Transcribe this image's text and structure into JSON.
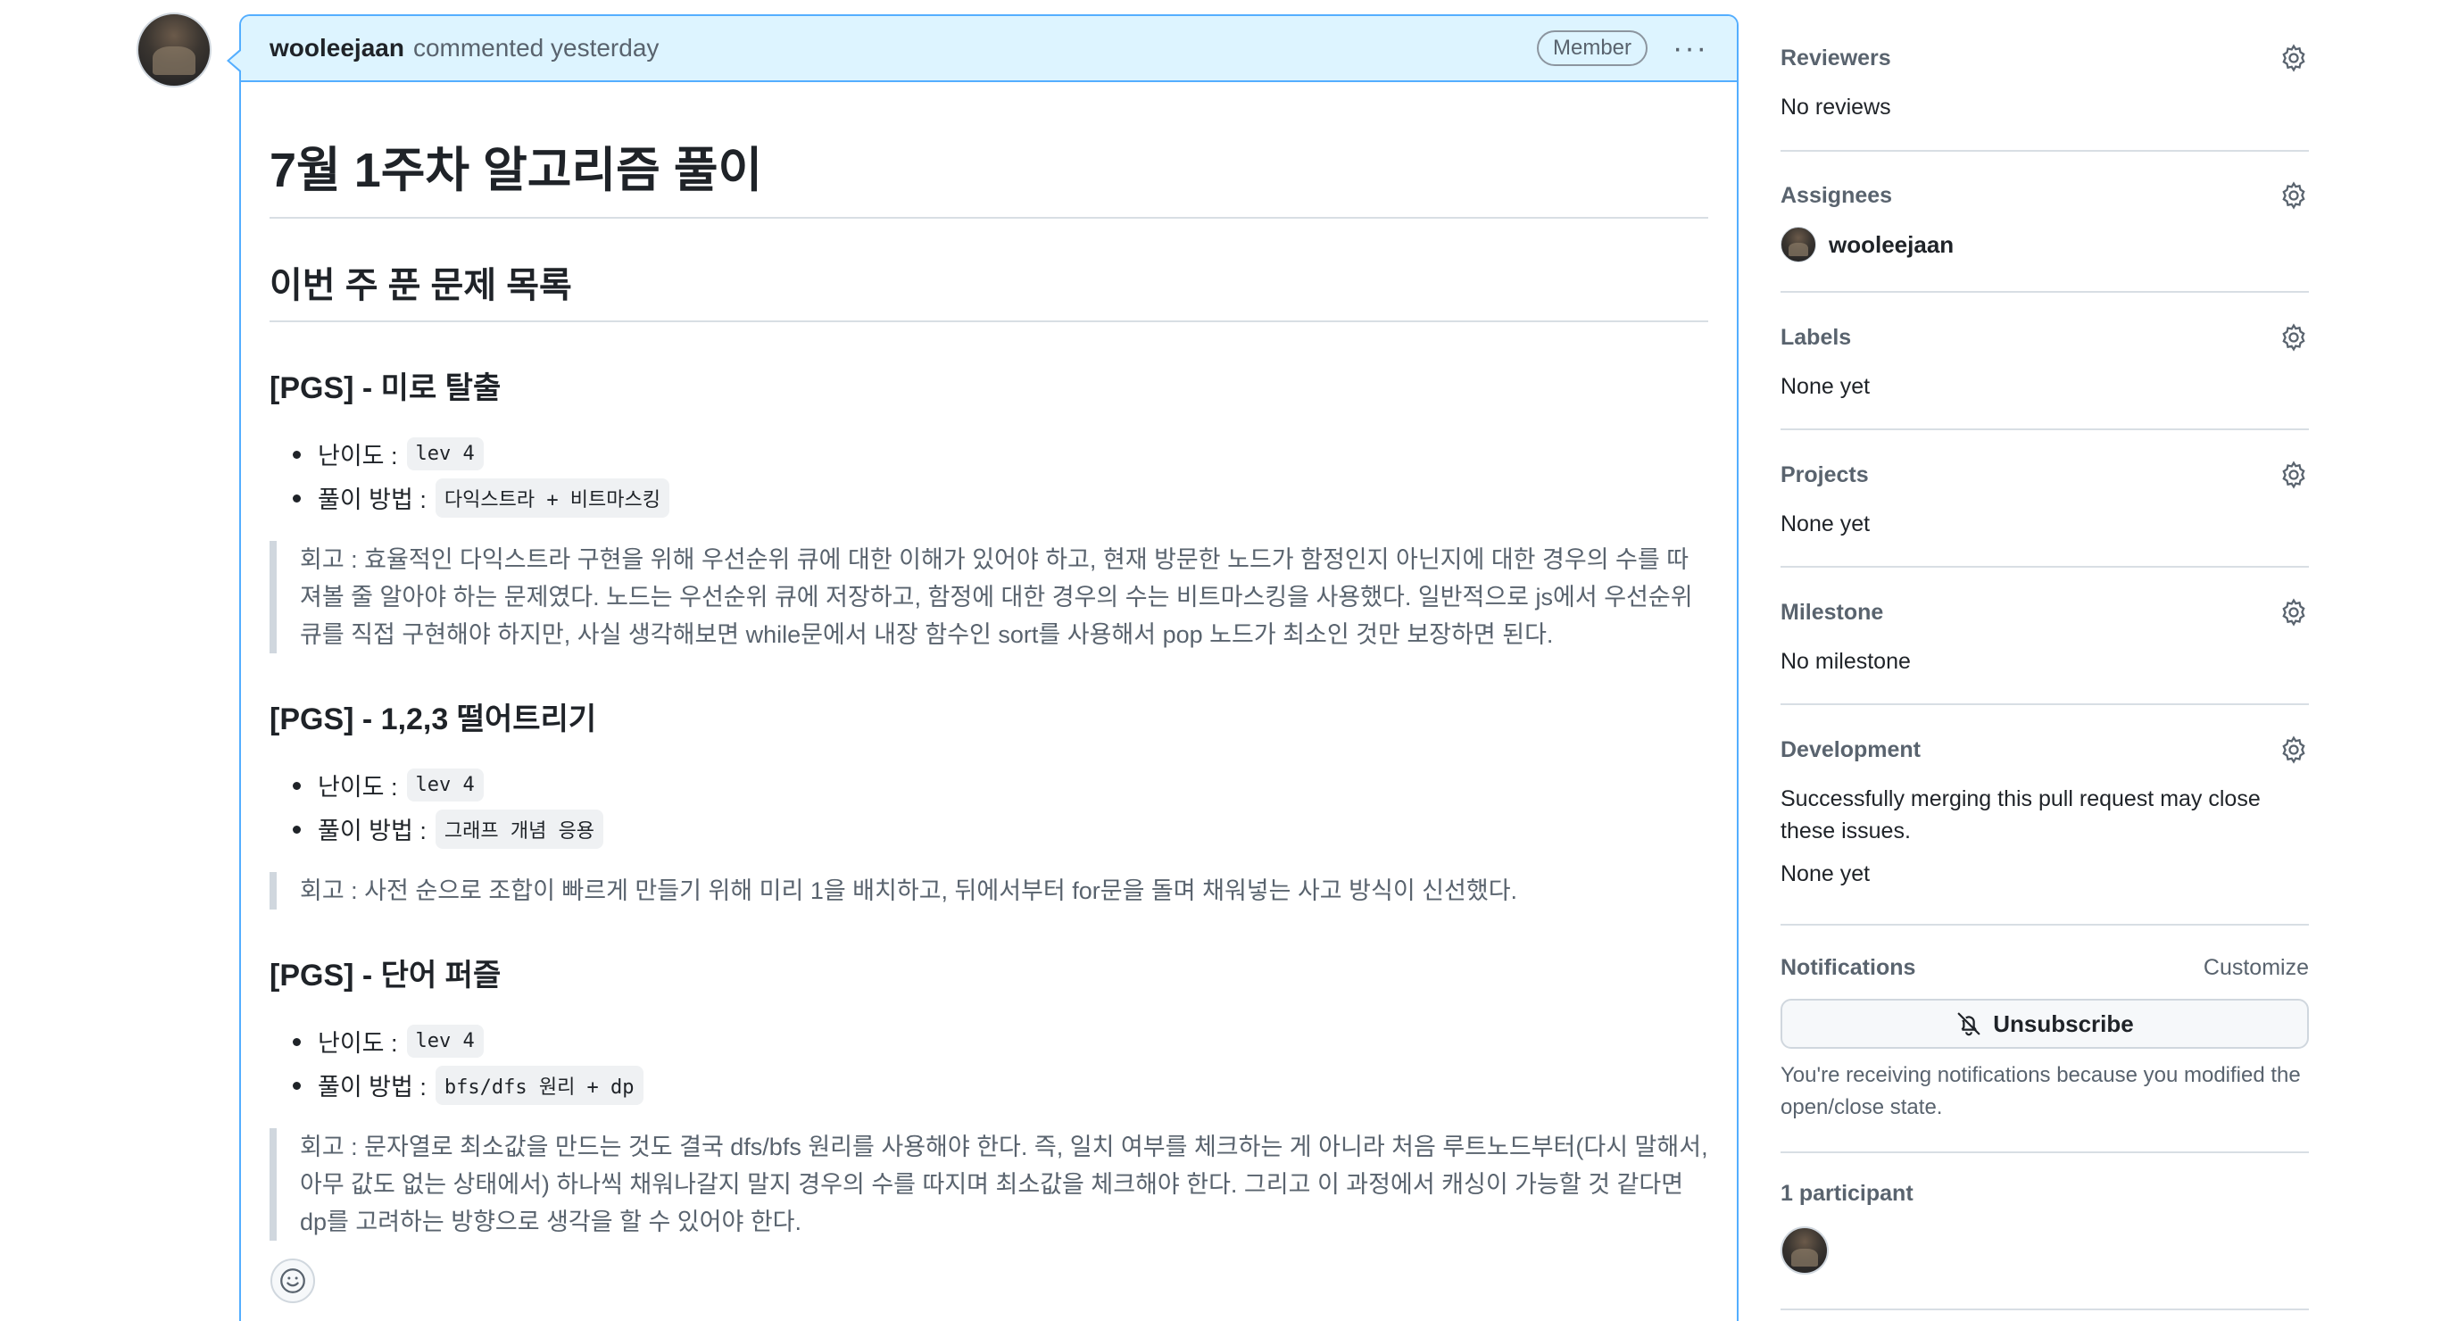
{
  "comment": {
    "author": "wooleejaan",
    "action": "commented yesterday",
    "role_badge": "Member",
    "menu_label": "···",
    "title": "7월 1주차 알고리즘 풀이",
    "subtitle": "이번 주 푼 문제 목록",
    "problems": [
      {
        "heading": "[PGS] - 미로 탈출",
        "difficulty_label": "난이도 :",
        "difficulty": "lev 4",
        "method_label": "풀이 방법 :",
        "method": "다익스트라 + 비트마스킹",
        "retro": "회고 : 효율적인 다익스트라 구현을 위해 우선순위 큐에 대한 이해가 있어야 하고, 현재 방문한 노드가 함정인지 아닌지에 대한 경우의 수를 따져볼 줄 알아야 하는 문제였다. 노드는 우선순위 큐에 저장하고, 함정에 대한 경우의 수는 비트마스킹을 사용했다. 일반적으로 js에서 우선순위 큐를 직접 구현해야 하지만, 사실 생각해보면 while문에서 내장 함수인 sort를 사용해서 pop 노드가 최소인 것만 보장하면 된다."
      },
      {
        "heading": "[PGS] - 1,2,3 떨어트리기",
        "difficulty_label": "난이도 :",
        "difficulty": "lev 4",
        "method_label": "풀이 방법 :",
        "method": "그래프 개념 응용",
        "retro": "회고 : 사전 순으로 조합이 빠르게 만들기 위해 미리 1을 배치하고, 뒤에서부터 for문을 돌며 채워넣는 사고 방식이 신선했다."
      },
      {
        "heading": "[PGS] - 단어 퍼즐",
        "difficulty_label": "난이도 :",
        "difficulty": "lev 4",
        "method_label": "풀이 방법 :",
        "method": "bfs/dfs 원리 + dp",
        "retro": "회고 : 문자열로 최소값을 만드는 것도 결국 dfs/bfs 원리를 사용해야 한다. 즉, 일치 여부를 체크하는 게 아니라 처음 루트노드부터(다시 말해서, 아무 값도 없는 상태에서) 하나씩 채워나갈지 말지 경우의 수를 따지며 최소값을 체크해야 한다. 그리고 이 과정에서 캐싱이 가능할 것 같다면 dp를 고려하는 방향으로 생각을 할 수 있어야 한다."
      }
    ]
  },
  "sidebar": {
    "reviewers": {
      "label": "Reviewers",
      "value": "No reviews"
    },
    "assignees": {
      "label": "Assignees",
      "value": "wooleejaan"
    },
    "labels": {
      "label": "Labels",
      "value": "None yet"
    },
    "projects": {
      "label": "Projects",
      "value": "None yet"
    },
    "milestone": {
      "label": "Milestone",
      "value": "No milestone"
    },
    "development": {
      "label": "Development",
      "description": "Successfully merging this pull request may close these issues.",
      "value": "None yet"
    },
    "notifications": {
      "label": "Notifications",
      "customize": "Customize",
      "button": "Unsubscribe",
      "note": "You're receiving notifications because you modified the open/close state."
    },
    "participants": {
      "label": "1 participant"
    }
  },
  "colors": {
    "header_bg": "#ddf4ff",
    "header_border": "#54aeff",
    "muted_text": "#59636e",
    "code_bg": "#eff1f3"
  },
  "icons": [
    "gear-icon",
    "bell-slash-icon",
    "smiley-icon",
    "kebab-horizontal-icon"
  ]
}
